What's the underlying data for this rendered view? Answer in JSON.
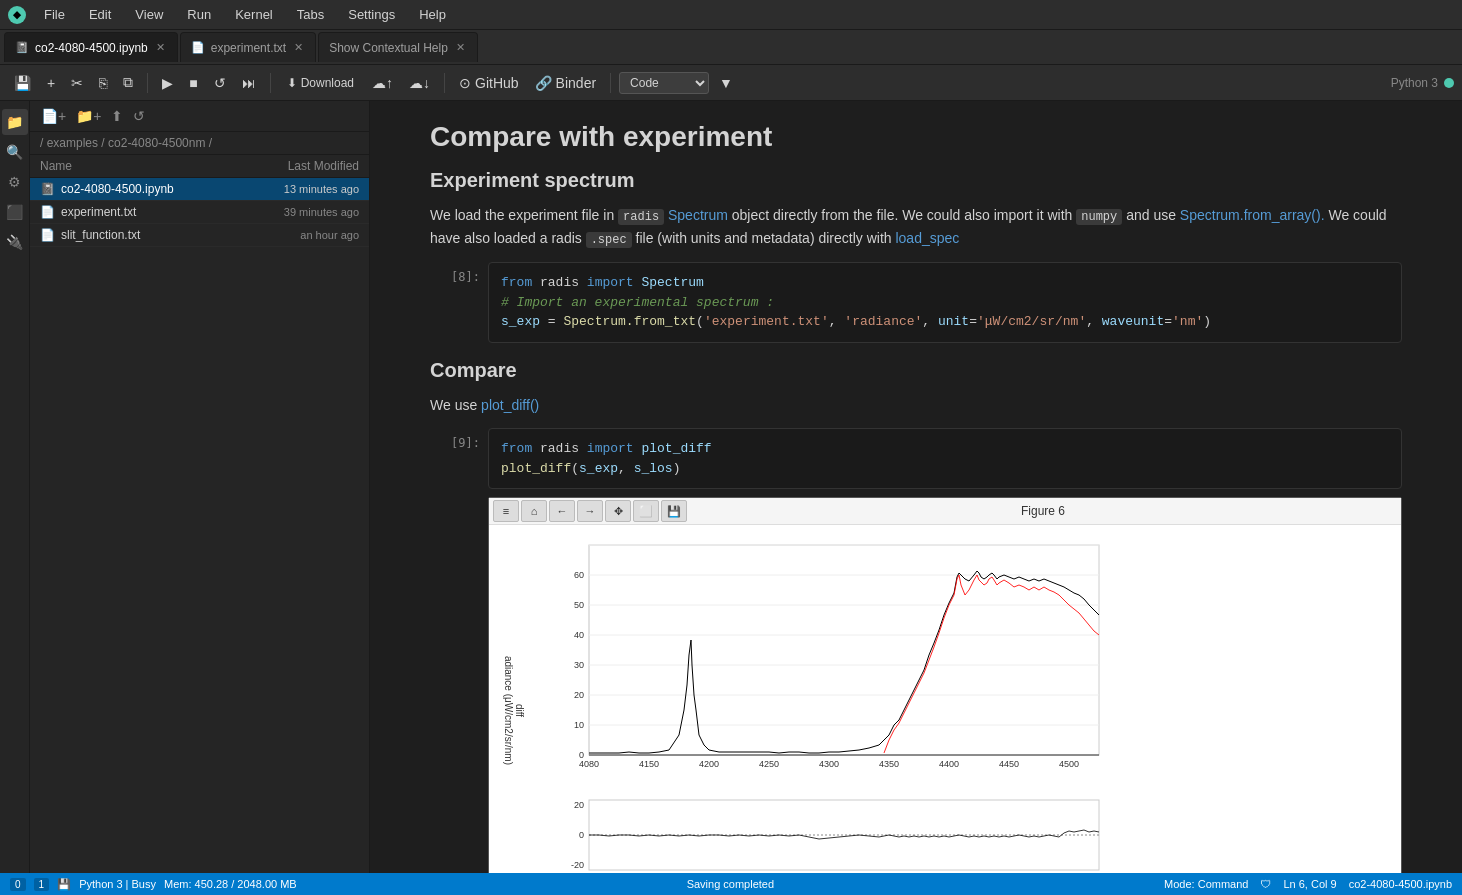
{
  "app": {
    "logo": "◆",
    "menu_items": [
      "File",
      "Edit",
      "View",
      "Run",
      "Kernel",
      "Tabs",
      "Settings",
      "Help"
    ]
  },
  "tabs": [
    {
      "id": "notebook",
      "label": "co2-4080-4500.ipynb",
      "active": true,
      "icon": "📓"
    },
    {
      "id": "experiment",
      "label": "experiment.txt",
      "active": false,
      "icon": "📄"
    },
    {
      "id": "help",
      "label": "Show Contextual Help",
      "active": false,
      "icon": "?"
    }
  ],
  "toolbar": {
    "save_icon": "💾",
    "add_icon": "+",
    "cut_icon": "✂",
    "copy_icon": "⎘",
    "paste_icon": "📋",
    "run_icon": "▶",
    "stop_icon": "■",
    "restart_icon": "↺",
    "fast_forward_icon": "⏭",
    "download_label": "Download",
    "upload_cloud_icon": "☁",
    "download_cloud_icon": "⬇",
    "github_label": "GitHub",
    "binder_label": "Binder",
    "code_mode": "Code",
    "kernel_name": "Python 3"
  },
  "file_panel": {
    "breadcrumb": "/ examples / co2-4080-4500nm /",
    "col_name": "Name",
    "col_modified": "Last Modified",
    "files": [
      {
        "name": "co2-4080-4500.ipynb",
        "modified": "13 minutes ago",
        "icon": "📓",
        "selected": true
      },
      {
        "name": "experiment.txt",
        "modified": "39 minutes ago",
        "icon": "📄",
        "selected": false
      },
      {
        "name": "slit_function.txt",
        "modified": "an hour ago",
        "icon": "📄",
        "selected": false
      }
    ]
  },
  "notebook": {
    "title": "Compare with experiment",
    "sections": [
      {
        "heading": "Experiment spectrum",
        "text_before": "We load the experiment file in",
        "code_inline_1": "radis",
        "link_1": "Spectrum",
        "text_mid_1": "object directly from the file. We could also import it with",
        "code_inline_2": "numpy",
        "text_mid_2": "and use",
        "link_2": "Spectrum.from_array().",
        "text_after": "We could have also loaded a radis",
        "code_inline_3": ".spec",
        "text_end": "file (with units and metadata) directly with",
        "link_3": "load_spec"
      }
    ],
    "cell_8": {
      "number": "[8]:",
      "lines": [
        "from radis import Spectrum",
        "# Import an experimental spectrum :",
        "s_exp = Spectrum.from_txt('experiment.txt', 'radiance', unit='μW/cm2/sr/nm', waveunit='nm')"
      ]
    },
    "compare_heading": "Compare",
    "compare_text": "We use",
    "compare_link": "plot_diff()",
    "cell_9": {
      "number": "[9]:",
      "lines": [
        "from radis import plot_diff",
        "plot_diff(s_exp, s_los)"
      ]
    },
    "figure": {
      "title": "Figure 6",
      "y_label": "adiance (μW/cm2/sr/nm)",
      "y_label_diff": "diff",
      "x_ticks": [
        "4080",
        "4150",
        "4200",
        "4250",
        "4300",
        "4350",
        "4400",
        "4450",
        "4500"
      ],
      "y_ticks_main": [
        "0",
        "10",
        "20",
        "30",
        "40",
        "50",
        "60"
      ],
      "y_ticks_diff": [
        "-20",
        "0",
        "20"
      ]
    }
  },
  "status_bar": {
    "cell_count": "0",
    "kernel_status_num": "1",
    "kernel_name": "Python 3 | Busy",
    "memory": "Mem: 450.28 / 2048.00 MB",
    "center_text": "Saving completed",
    "mode": "Mode: Command",
    "cursor": "Ln 6, Col 9",
    "filename": "co2-4080-4500.ipynb"
  },
  "sidebar_icons": {
    "icons": [
      "📁",
      "🔍",
      "🔧",
      "⬛",
      "🔌"
    ]
  }
}
